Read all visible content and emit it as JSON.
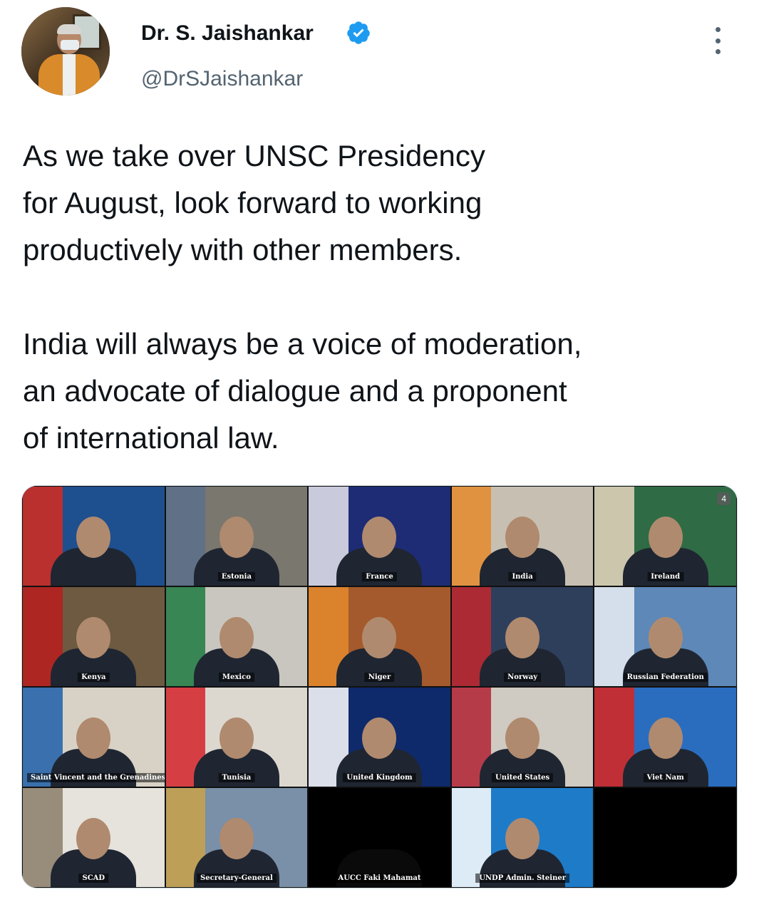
{
  "author": {
    "name": "Dr. S. Jaishankar",
    "handle": "@DrSJaishankar",
    "verified": true,
    "verified_color": "#1d9bf0"
  },
  "tweet": {
    "text": "As we take over UNSC Presidency\nfor August, look forward to working\nproductively with other members.\n\nIndia will always be a voice of moderation,\nan advocate of dialogue and a proponent\nof international law."
  },
  "media": {
    "participant_count": "4",
    "tiles": [
      {
        "label": "",
        "bg": "#1e4f8f",
        "accent": "#d62a1e"
      },
      {
        "label": "Estonia",
        "bg": "#7a776e",
        "accent": "#5b6e8c"
      },
      {
        "label": "France",
        "bg": "#1d2c74",
        "accent": "#e8e8ee"
      },
      {
        "label": "India",
        "bg": "#c7c0b2",
        "accent": "#e58a2d"
      },
      {
        "label": "Ireland",
        "bg": "#2f6b45",
        "accent": "#e8d6c0"
      },
      {
        "label": "Kenya",
        "bg": "#6d5a40",
        "accent": "#b81d1d"
      },
      {
        "label": "Mexico",
        "bg": "#c9c6bf",
        "accent": "#1f7a3f"
      },
      {
        "label": "Niger",
        "bg": "#a45a2c",
        "accent": "#e58a2d"
      },
      {
        "label": "Norway",
        "bg": "#2e3f5c",
        "accent": "#c1272d"
      },
      {
        "label": "Russian Federation",
        "bg": "#5d88b8",
        "accent": "#e9eef3"
      },
      {
        "label": "Saint Vincent and the Grenadines",
        "bg": "#d8d2c6",
        "accent": "#1f5fa8"
      },
      {
        "label": "Tunisia",
        "bg": "#dcd8d0",
        "accent": "#d3242a"
      },
      {
        "label": "United Kingdom",
        "bg": "#0e2a6b",
        "accent": "#ffffff"
      },
      {
        "label": "United States",
        "bg": "#cfcac2",
        "accent": "#b22234"
      },
      {
        "label": "Viet Nam",
        "bg": "#2a6dbf",
        "accent": "#da251d"
      },
      {
        "label": "SCAD",
        "bg": "#e6e2dc",
        "accent": "#8a7d6a"
      },
      {
        "label": "Secretary-General",
        "bg": "#7a8fa8",
        "accent": "#c9a24a"
      },
      {
        "label": "AUCC Faki Mahamat",
        "bg": "#000000",
        "accent": "#000000"
      },
      {
        "label": "UNDP Admin. Steiner",
        "bg": "#1e7bc8",
        "accent": "#ffffff"
      },
      {
        "label": "",
        "bg": "#000000",
        "accent": "#000000"
      }
    ]
  }
}
